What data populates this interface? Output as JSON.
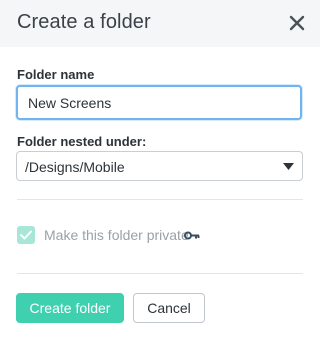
{
  "dialog": {
    "title": "Create a folder",
    "close_icon": "close-icon"
  },
  "form": {
    "folder_name_label": "Folder name",
    "folder_name_value": "New Screens",
    "nested_label": "Folder nested under:",
    "nested_value": "/Designs/Mobile",
    "private_label": "Make this folder private",
    "private_checked": true,
    "private_icon": "key-icon"
  },
  "actions": {
    "create_label": "Create folder",
    "cancel_label": "Cancel"
  },
  "colors": {
    "primary": "#3fd0b0",
    "focus_border": "#70b5f2",
    "header_bg": "#f4f6f8"
  }
}
